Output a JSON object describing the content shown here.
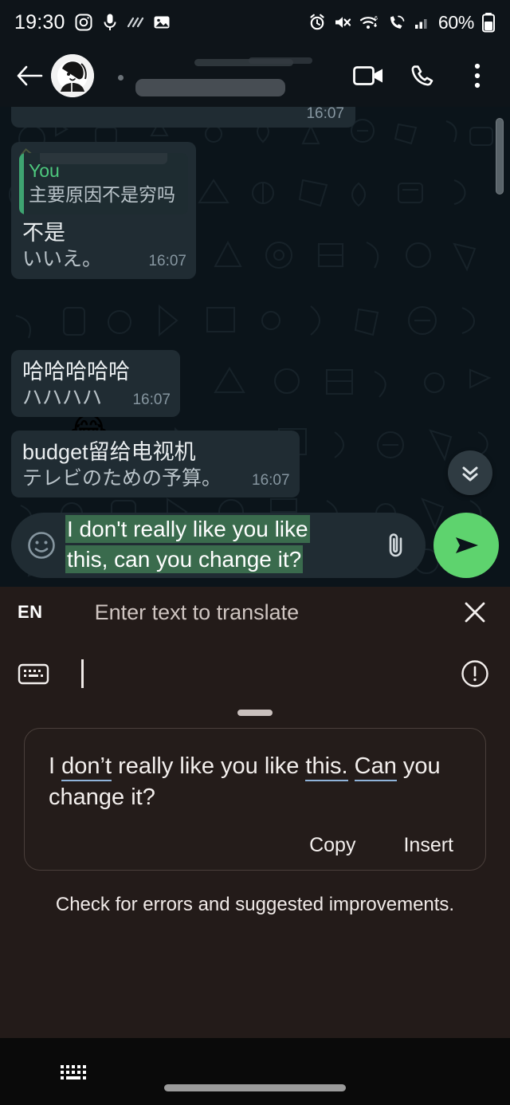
{
  "status_bar": {
    "time": "19:30",
    "battery_percent": "60%",
    "left_icons": [
      "instagram-icon",
      "microphone-icon",
      "motion-lines-icon",
      "image-icon"
    ],
    "right_icons": [
      "alarm-icon",
      "mute-icon",
      "wifi-icon",
      "call-wifi-icon",
      "signal-icon"
    ]
  },
  "app_bar": {
    "back_label": "back-arrow",
    "contact_name": "",
    "actions": [
      "video-call",
      "voice-call",
      "more-options"
    ]
  },
  "chat": {
    "messages": [
      {
        "id": "cut-off",
        "text": "",
        "translation": "",
        "time": "16:07"
      },
      {
        "id": "quoted-reply",
        "quote_author": "You",
        "quote_text": "主要原因不是穷吗",
        "text": "不是",
        "translation": "いいえ。",
        "time": "16:07"
      },
      {
        "id": "emoji",
        "text": "😂",
        "translation": "",
        "time": ""
      },
      {
        "id": "haha",
        "text": "哈哈哈哈哈",
        "translation": "ハハハハ",
        "time": "16:07"
      },
      {
        "id": "budget",
        "text": "budget留给电视机",
        "translation": "テレビのための予算。",
        "time": "16:07"
      }
    ],
    "scroll_to_bottom": "chevron-double-down-icon"
  },
  "composer": {
    "text": "I don't really like you like this, can you change it?",
    "text_line1": "I don't really like you like",
    "text_line2": "this, can you change it?",
    "emoji_button": "emoji-icon",
    "attach_button": "paperclip-icon",
    "send_button": "send-icon",
    "send_color": "#5ed36e"
  },
  "translate_panel": {
    "language": "EN",
    "placeholder": "Enter text to translate",
    "close_label": "close-icon",
    "keyboard_switch": "keyboard-icon",
    "warning_label": "error-icon",
    "suggestion": {
      "segments": [
        {
          "text": "I ",
          "underline": false
        },
        {
          "text": "don’t",
          "underline": true
        },
        {
          "text": " really like you like ",
          "underline": false
        },
        {
          "text": "this.",
          "underline": true
        },
        {
          "text": " ",
          "underline": false
        },
        {
          "text": "Can",
          "underline": true
        },
        {
          "text": " you change it?",
          "underline": false
        }
      ],
      "full_text": "I don’t really like you like this. Can you change it?",
      "copy_label": "Copy",
      "insert_label": "Insert"
    },
    "hint": "Check for errors and suggested improvements.",
    "underline_color": "#8fb3d9"
  },
  "nav_bar": {
    "keyboard_icon": "keyboard-icon",
    "home_indicator": "home-indicator"
  }
}
